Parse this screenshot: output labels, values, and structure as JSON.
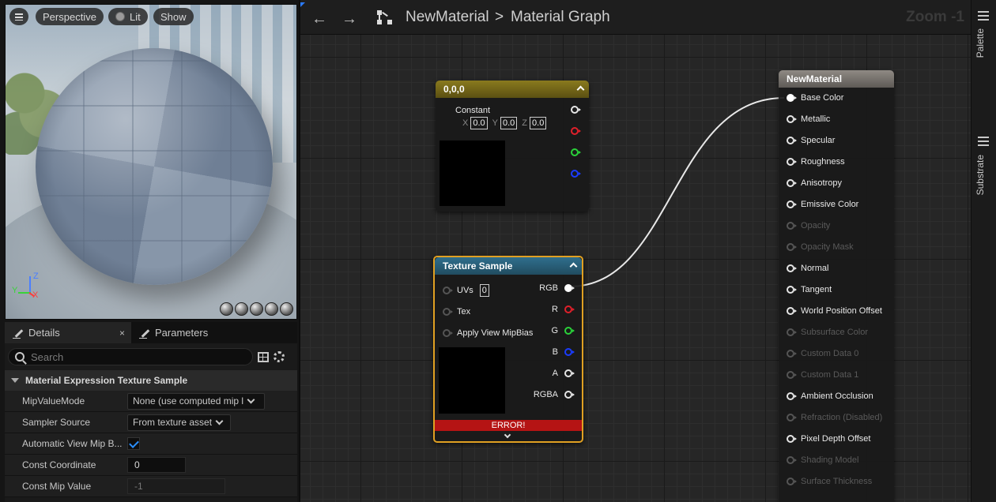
{
  "viewport": {
    "perspective_label": "Perspective",
    "lit_label": "Lit",
    "show_label": "Show",
    "axis": {
      "z": "Z",
      "y": "Y",
      "x": "X"
    }
  },
  "details": {
    "tab_details": "Details",
    "tab_close": "×",
    "tab_parameters": "Parameters",
    "search_placeholder": "Search",
    "section_title": "Material Expression Texture Sample",
    "props": [
      {
        "label": "MipValueMode",
        "value": "None (use computed mip level)"
      },
      {
        "label": "Sampler Source",
        "value": "From texture asset"
      },
      {
        "label": "Automatic View Mip B...",
        "checked": true
      },
      {
        "label": "Const Coordinate",
        "value": "0"
      },
      {
        "label": "Const Mip Value",
        "value": "-1"
      }
    ]
  },
  "graph": {
    "breadcrumb_material": "NewMaterial",
    "breadcrumb_separator": ">",
    "breadcrumb_graph": "Material Graph",
    "zoom_label": "Zoom -1",
    "const_node": {
      "title": "0,0,0",
      "subtitle": "Constant",
      "x_label": "X",
      "x_value": "0.0",
      "y_label": "Y",
      "y_value": "0.0",
      "z_label": "Z",
      "z_value": "0.0"
    },
    "tex_node": {
      "title": "Texture Sample",
      "inputs": {
        "uvs": "UVs",
        "uvs_value": "0",
        "tex": "Tex",
        "mipbias": "Apply View MipBias"
      },
      "outputs": {
        "rgb": "RGB",
        "r": "R",
        "g": "G",
        "b": "B",
        "a": "A",
        "rgba": "RGBA"
      },
      "error": "ERROR!"
    },
    "mat_node": {
      "title": "NewMaterial",
      "pins": [
        {
          "label": "Base Color",
          "enabled": true,
          "connected": true
        },
        {
          "label": "Metallic",
          "enabled": true
        },
        {
          "label": "Specular",
          "enabled": true
        },
        {
          "label": "Roughness",
          "enabled": true
        },
        {
          "label": "Anisotropy",
          "enabled": true
        },
        {
          "label": "Emissive Color",
          "enabled": true
        },
        {
          "label": "Opacity",
          "enabled": false
        },
        {
          "label": "Opacity Mask",
          "enabled": false
        },
        {
          "label": "Normal",
          "enabled": true
        },
        {
          "label": "Tangent",
          "enabled": true
        },
        {
          "label": "World Position Offset",
          "enabled": true
        },
        {
          "label": "Subsurface Color",
          "enabled": false
        },
        {
          "label": "Custom Data 0",
          "enabled": false
        },
        {
          "label": "Custom Data 1",
          "enabled": false
        },
        {
          "label": "Ambient Occlusion",
          "enabled": true
        },
        {
          "label": "Refraction (Disabled)",
          "enabled": false
        },
        {
          "label": "Pixel Depth Offset",
          "enabled": true
        },
        {
          "label": "Shading Model",
          "enabled": false
        },
        {
          "label": "Surface Thickness",
          "enabled": false
        }
      ]
    }
  },
  "sidebar": {
    "palette": "Palette",
    "substrate": "Substrate"
  }
}
